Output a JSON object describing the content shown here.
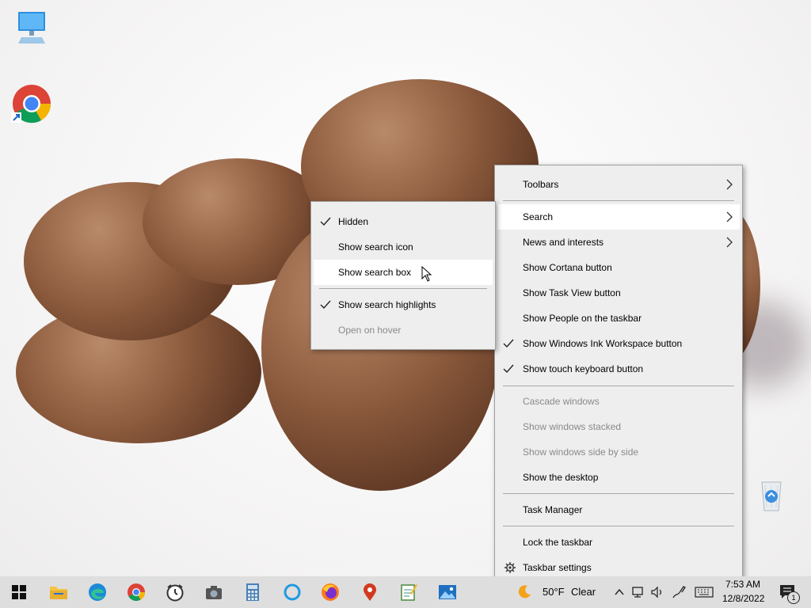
{
  "desktop": {
    "icons": [
      {
        "name": "this-pc-icon"
      },
      {
        "name": "chrome-shortcut-icon"
      },
      {
        "name": "recycle-bin-icon"
      }
    ]
  },
  "taskbar_menu": {
    "items": [
      {
        "label": "Toolbars",
        "submenu": true
      },
      {
        "label": "Search",
        "submenu": true
      },
      {
        "label": "News and interests",
        "submenu": true
      },
      {
        "label": "Show Cortana button"
      },
      {
        "label": "Show Task View button"
      },
      {
        "label": "Show People on the taskbar"
      },
      {
        "label": "Show Windows Ink Workspace button",
        "checked": true
      },
      {
        "label": "Show touch keyboard button",
        "checked": true
      },
      {
        "label": "Cascade windows",
        "disabled": true
      },
      {
        "label": "Show windows stacked",
        "disabled": true
      },
      {
        "label": "Show windows side by side",
        "disabled": true
      },
      {
        "label": "Show the desktop"
      },
      {
        "label": "Task Manager"
      },
      {
        "label": "Lock the taskbar"
      },
      {
        "label": "Taskbar settings",
        "icon": "gear-icon"
      }
    ]
  },
  "search_submenu": {
    "items": [
      {
        "label": "Hidden",
        "checked": true
      },
      {
        "label": "Show search icon"
      },
      {
        "label": "Show search box"
      },
      {
        "label": "Show search highlights",
        "checked": true
      },
      {
        "label": "Open on hover",
        "disabled": true
      }
    ]
  },
  "taskbar": {
    "apps": [
      "start-button",
      "file-explorer",
      "edge",
      "chrome",
      "clock",
      "camera",
      "calculator",
      "cortana",
      "firefox",
      "maps",
      "notepad",
      "photos"
    ],
    "weather": {
      "temp": "50°F",
      "condition": "Clear"
    },
    "clock": {
      "time": "7:53 AM",
      "date": "12/8/2022"
    },
    "notification_count": "1"
  }
}
